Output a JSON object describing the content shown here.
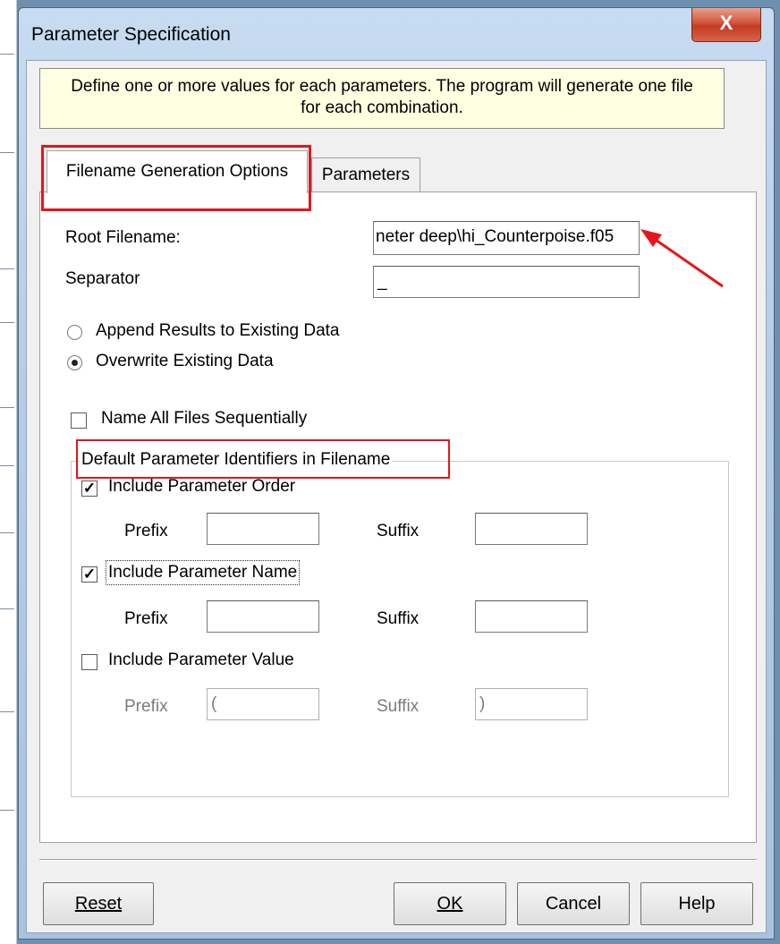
{
  "window": {
    "title": "Parameter Specification",
    "close_label": "X"
  },
  "info": {
    "line1": "Define one or more values for each parameters. The program will generate one file",
    "line2": "for each combination."
  },
  "tabs": [
    {
      "label": "Filename Generation Options",
      "active": true
    },
    {
      "label": "Parameters",
      "active": false
    }
  ],
  "form": {
    "root_filename_label": "Root Filename:",
    "root_filename_value": "neter deep\\hi_Counterpoise.f05",
    "separator_label": "Separator",
    "separator_value": "_",
    "radio_append": {
      "label": "Append Results to Existing Data",
      "checked": false
    },
    "radio_overwrite": {
      "label": "Overwrite Existing Data",
      "checked": true
    },
    "name_sequentially": {
      "label": "Name All Files Sequentially",
      "checked": false
    }
  },
  "group": {
    "title": "Default Parameter Identifiers in Filename",
    "order": {
      "label": "Include Parameter Order",
      "checked": true,
      "prefix_label": "Prefix",
      "prefix_value": "",
      "suffix_label": "Suffix",
      "suffix_value": ""
    },
    "name": {
      "label": "Include Parameter Name",
      "checked": true,
      "prefix_label": "Prefix",
      "prefix_value": "",
      "suffix_label": "Suffix",
      "suffix_value": ""
    },
    "value": {
      "label": "Include Parameter Value",
      "checked": false,
      "prefix_label": "Prefix",
      "prefix_value": "(",
      "suffix_label": "Suffix",
      "suffix_value": ")"
    }
  },
  "buttons": {
    "reset": "Reset",
    "ok": "OK",
    "cancel": "Cancel",
    "help": "Help"
  },
  "colors": {
    "annotation_red": "#e4161b",
    "info_bg": "#ffffe1",
    "close_red": "#c33a22"
  }
}
